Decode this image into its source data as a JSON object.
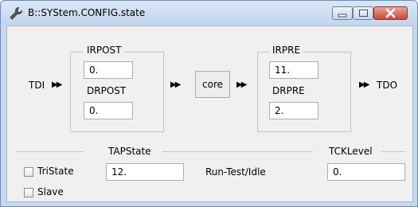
{
  "window": {
    "title": "B::SYStem.CONFIG.state"
  },
  "chain": {
    "tdi_label": "TDI",
    "tdo_label": "TDO",
    "arrow_glyph": "▶▶",
    "core_label": "core"
  },
  "left_group": {
    "irpost_label": "IRPOST",
    "irpost_value": "0.",
    "drpost_label": "DRPOST",
    "drpost_value": "0."
  },
  "right_group": {
    "irpre_label": "IRPRE",
    "irpre_value": "11.",
    "drpre_label": "DRPRE",
    "drpre_value": "2."
  },
  "tapstate": {
    "label": "TAPState",
    "value": "12.",
    "state_name": "Run-Test/Idle"
  },
  "tcklevel": {
    "label": "TCKLevel",
    "value": "0."
  },
  "options": {
    "tristate_label": "TriState",
    "tristate_checked": false,
    "slave_label": "Slave",
    "slave_checked": false
  }
}
